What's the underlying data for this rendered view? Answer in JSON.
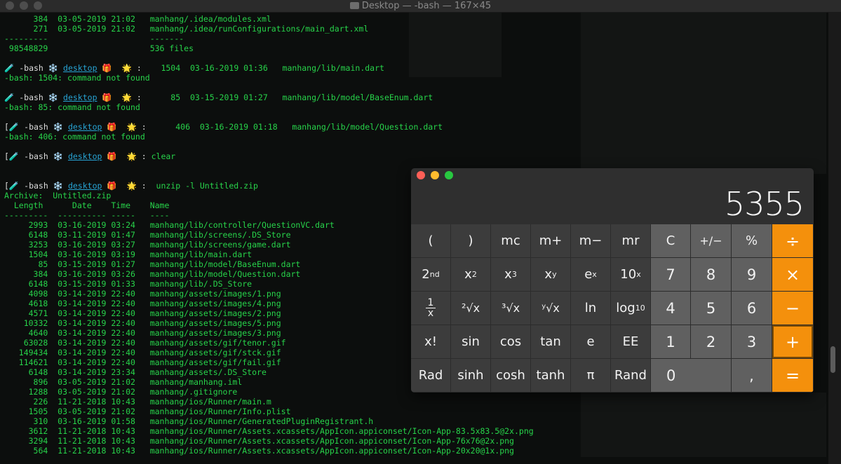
{
  "window": {
    "title": "Desktop — -bash — 167×45"
  },
  "terminal": {
    "lines": [
      {
        "text": "      384  03-05-2019 21:02   manhang/.idea/modules.xml"
      },
      {
        "text": "      271  03-05-2019 21:02   manhang/.idea/runConfigurations/main_dart.xml"
      },
      {
        "text": "---------                     -------"
      },
      {
        "text": " 98548829                     536 files"
      },
      {
        "text": ""
      },
      {
        "prompt": true,
        "lead": "🧪 -bash ❄️ ",
        "dir": "desktop",
        "tail": " 🎁  🌟 :",
        "text": "    1504  03-16-2019 01:36   manhang/lib/main.dart"
      },
      {
        "text": "-bash: 1504: command not found"
      },
      {
        "text": ""
      },
      {
        "prompt": true,
        "lead": "🧪 -bash ❄️ ",
        "dir": "desktop",
        "tail": " 🎁  🌟 :",
        "text": "      85  03-15-2019 01:27   manhang/lib/model/BaseEnum.dart"
      },
      {
        "text": "-bash: 85: command not found"
      },
      {
        "text": ""
      },
      {
        "prompt": true,
        "lead": "[🧪 -bash ❄️ ",
        "dir": "desktop",
        "tail": " 🎁  🌟 :",
        "text": "      406  03-16-2019 01:18   manhang/lib/model/Question.dart"
      },
      {
        "text": "-bash: 406: command not found"
      },
      {
        "text": ""
      },
      {
        "prompt": true,
        "lead": "[🧪 -bash ❄️ ",
        "dir": "desktop",
        "tail": " 🎁  🌟 :",
        "text": " clear"
      },
      {
        "text": ""
      },
      {
        "text": ""
      },
      {
        "prompt": true,
        "lead": "[🧪 -bash ❄️ ",
        "dir": "desktop",
        "tail": " 🎁  🌟 :",
        "text": "  unzip -l Untitled.zip"
      },
      {
        "text": "Archive:  Untitled.zip"
      },
      {
        "text": "  Length      Date    Time    Name"
      },
      {
        "text": "---------  ---------- -----   ----"
      },
      {
        "text": "     2993  03-16-2019 03:24   manhang/lib/controller/QuestionVC.dart"
      },
      {
        "text": "     6148  03-11-2019 01:47   manhang/lib/screens/.DS_Store"
      },
      {
        "text": "     3253  03-16-2019 03:27   manhang/lib/screens/game.dart"
      },
      {
        "text": "     1504  03-16-2019 03:19   manhang/lib/main.dart"
      },
      {
        "text": "       85  03-15-2019 01:27   manhang/lib/model/BaseEnum.dart"
      },
      {
        "text": "      384  03-16-2019 03:26   manhang/lib/model/Question.dart"
      },
      {
        "text": "     6148  03-15-2019 01:33   manhang/lib/.DS_Store"
      },
      {
        "text": "     4098  03-14-2019 22:40   manhang/assets/images/1.png"
      },
      {
        "text": "     4618  03-14-2019 22:40   manhang/assets/images/4.png"
      },
      {
        "text": "     4571  03-14-2019 22:40   manhang/assets/images/2.png"
      },
      {
        "text": "    10332  03-14-2019 22:40   manhang/assets/images/5.png"
      },
      {
        "text": "     4640  03-14-2019 22:40   manhang/assets/images/3.png"
      },
      {
        "text": "    63028  03-14-2019 22:40   manhang/assets/gif/tenor.gif"
      },
      {
        "text": "   149434  03-14-2019 22:40   manhang/assets/gif/stck.gif"
      },
      {
        "text": "   114621  03-14-2019 22:40   manhang/assets/gif/fail.gif"
      },
      {
        "text": "     6148  03-14-2019 23:34   manhang/assets/.DS_Store"
      },
      {
        "text": "      896  03-05-2019 21:02   manhang/manhang.iml"
      },
      {
        "text": "     1288  03-05-2019 21:02   manhang/.gitignore"
      },
      {
        "text": "      226  11-21-2018 10:43   manhang/ios/Runner/main.m"
      },
      {
        "text": "     1505  03-05-2019 21:02   manhang/ios/Runner/Info.plist"
      },
      {
        "text": "      310  03-16-2019 01:58   manhang/ios/Runner/GeneratedPluginRegistrant.h"
      },
      {
        "text": "     3612  11-21-2018 10:43   manhang/ios/Runner/Assets.xcassets/AppIcon.appiconset/Icon-App-83.5x83.5@2x.png"
      },
      {
        "text": "     3294  11-21-2018 10:43   manhang/ios/Runner/Assets.xcassets/AppIcon.appiconset/Icon-App-76x76@2x.png"
      },
      {
        "text": "      564  11-21-2018 10:43   manhang/ios/Runner/Assets.xcassets/AppIcon.appiconset/Icon-App-20x20@1x.png"
      }
    ]
  },
  "calculator": {
    "display": "5355",
    "colors": {
      "operator": "#f4900c",
      "number_key": "#606060",
      "sci_key": "#3c3c3c",
      "body": "#2f2f2f"
    },
    "keys": {
      "lparen": "(",
      "rparen": ")",
      "mc": "mc",
      "mplus": "m+",
      "mminus": "m−",
      "mr": "mr",
      "clear": "C",
      "sign": "+/−",
      "percent": "%",
      "divide": "÷",
      "second_base": "2",
      "second_sup": "nd",
      "x2_base": "x",
      "x2_sup": "2",
      "x3_base": "x",
      "x3_sup": "3",
      "xy_base": "x",
      "xy_sup": "y",
      "ex_base": "e",
      "ex_sup": "x",
      "tenx_base": "10",
      "tenx_sup": "x",
      "seven": "7",
      "eight": "8",
      "nine": "9",
      "multiply": "×",
      "inv_num": "1",
      "inv_den": "x",
      "sqrt2": "²√x",
      "sqrt3": "³√x",
      "sqrty": "ʸ√x",
      "ln": "ln",
      "log_base": "log",
      "log_sub": "10",
      "four": "4",
      "five": "5",
      "six": "6",
      "minus": "−",
      "fact": "x!",
      "sin": "sin",
      "cos": "cos",
      "tan": "tan",
      "e": "e",
      "ee": "EE",
      "one": "1",
      "two": "2",
      "three": "3",
      "plus": "+",
      "rad": "Rad",
      "sinh": "sinh",
      "cosh": "cosh",
      "tanh": "tanh",
      "pi": "π",
      "rand": "Rand",
      "zero": "0",
      "decimal": ",",
      "equals": "="
    }
  }
}
